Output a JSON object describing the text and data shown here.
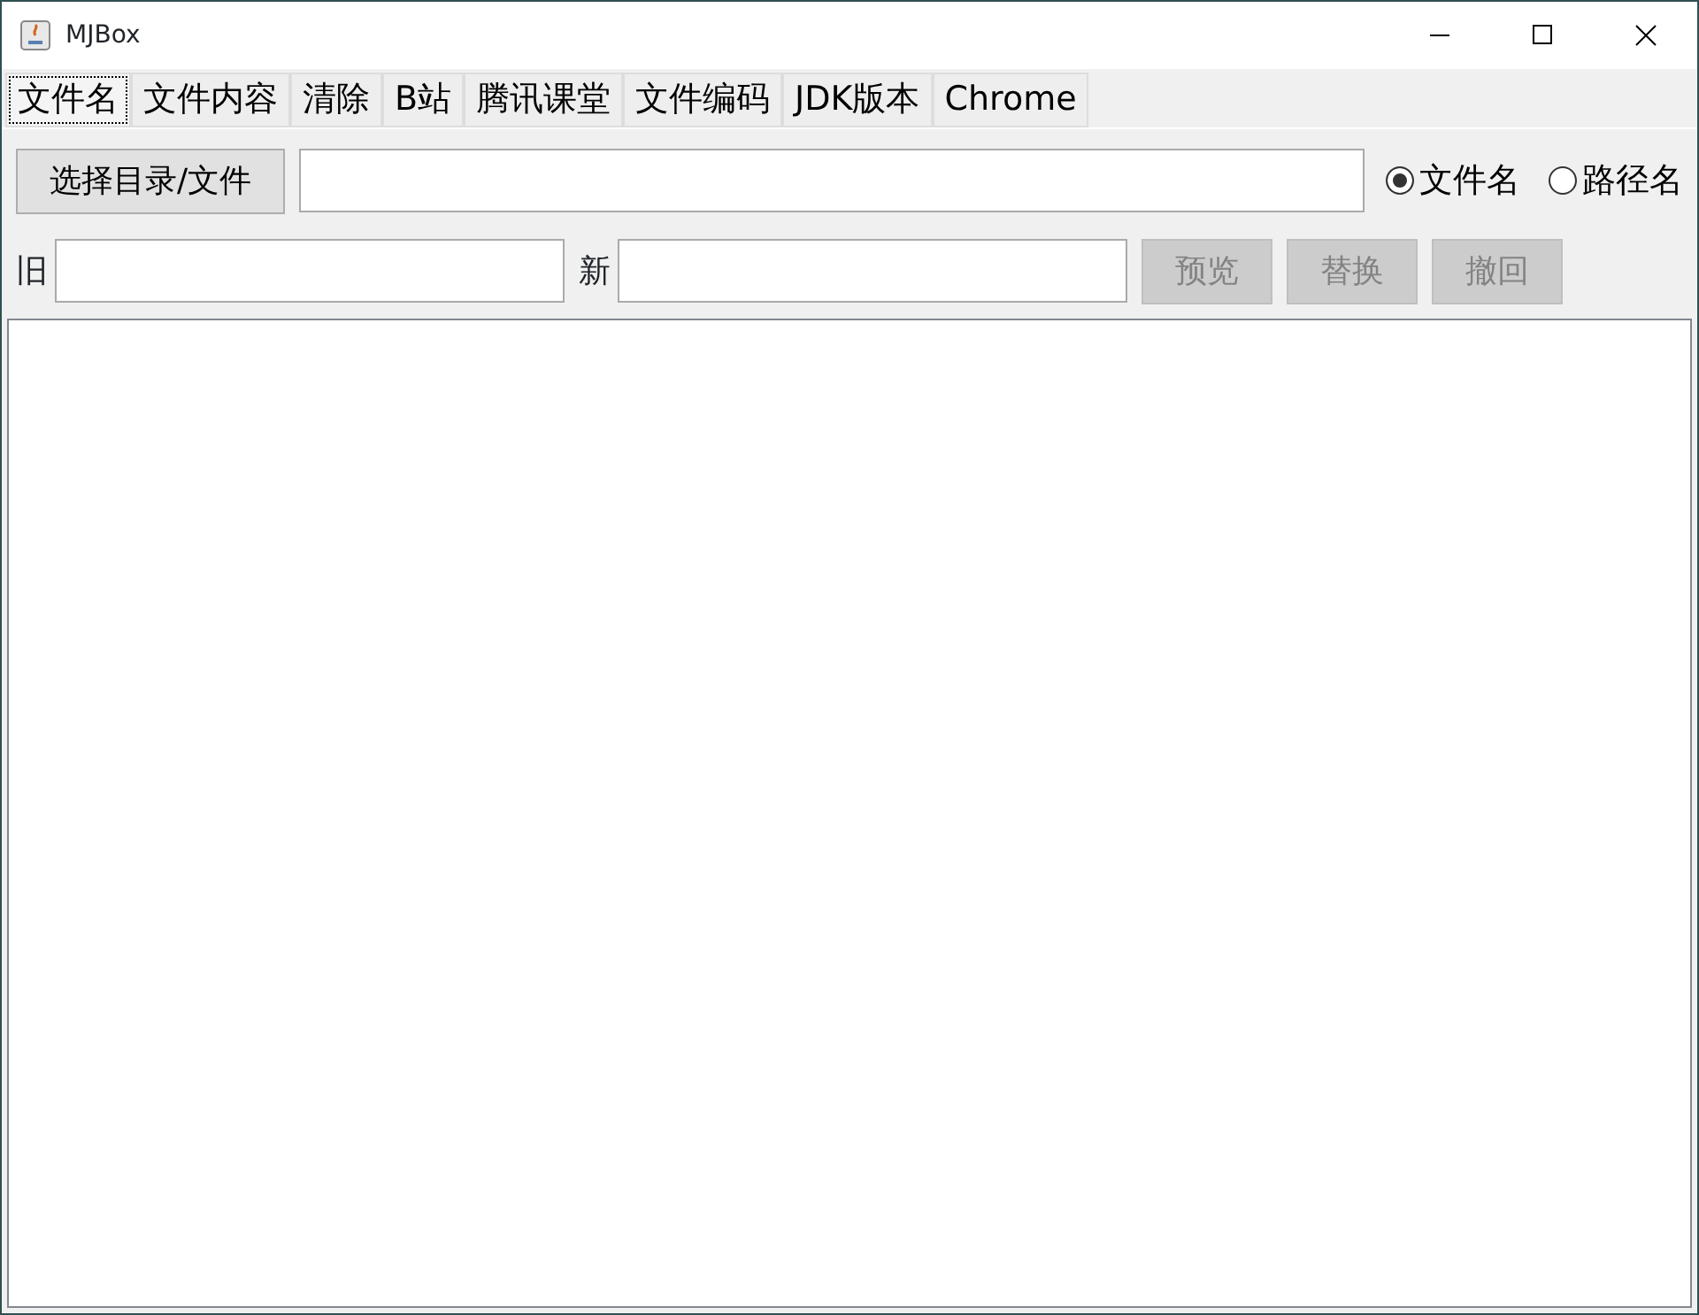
{
  "window": {
    "title": "MJBox"
  },
  "tabs": [
    {
      "label": "文件名",
      "selected": true
    },
    {
      "label": "文件内容",
      "selected": false
    },
    {
      "label": "清除",
      "selected": false
    },
    {
      "label": "B站",
      "selected": false
    },
    {
      "label": "腾讯课堂",
      "selected": false
    },
    {
      "label": "文件编码",
      "selected": false
    },
    {
      "label": "JDK版本",
      "selected": false
    },
    {
      "label": "Chrome",
      "selected": false
    }
  ],
  "choose_button": {
    "label": "选择目录/文件"
  },
  "radios": [
    {
      "label": "文件名",
      "selected": true
    },
    {
      "label": "路径名",
      "selected": false
    }
  ],
  "old_label": "旧",
  "new_label": "新",
  "buttons": [
    {
      "label": "预览",
      "disabled": true
    },
    {
      "label": "替换",
      "disabled": true
    },
    {
      "label": "撤回",
      "disabled": true
    }
  ]
}
